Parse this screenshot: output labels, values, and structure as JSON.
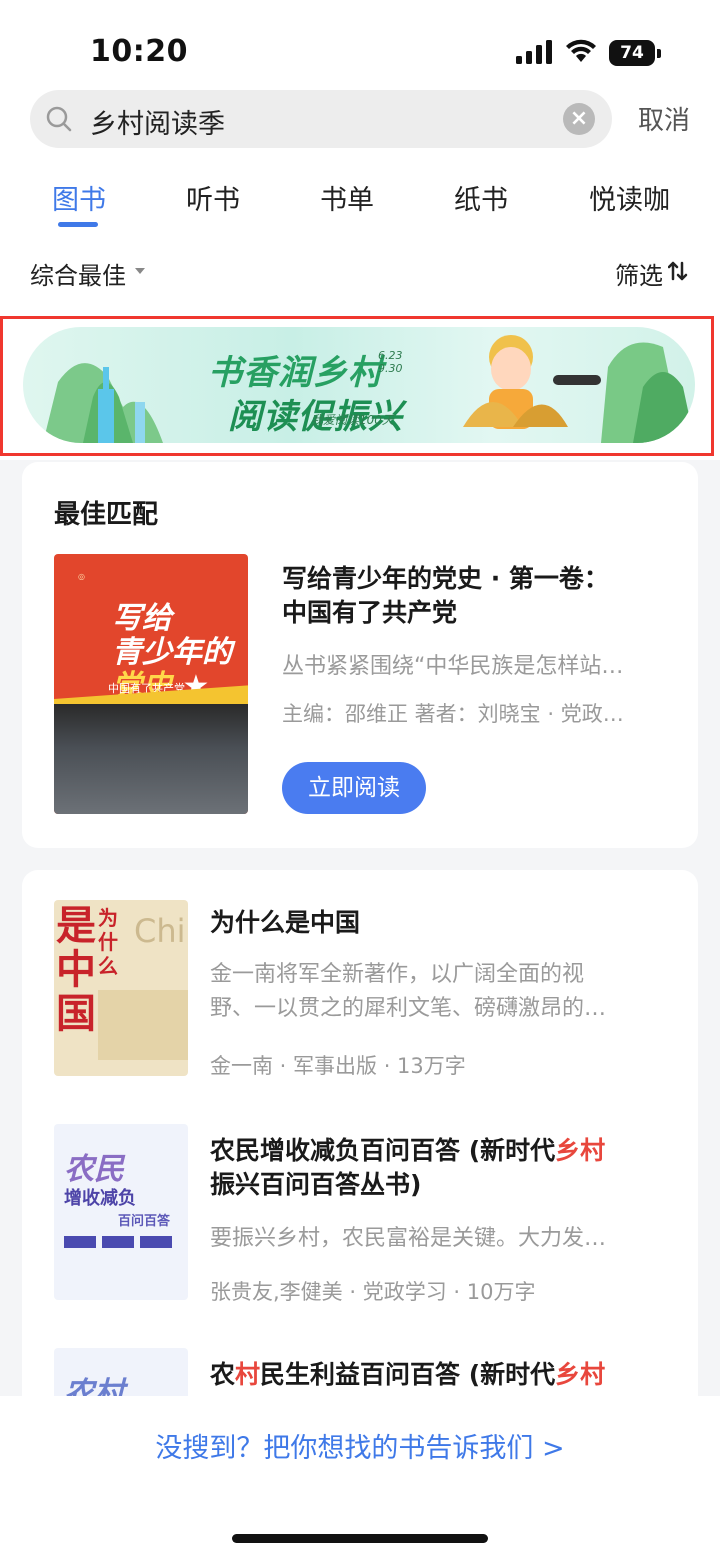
{
  "status_bar": {
    "time": "10:20",
    "battery": "74"
  },
  "search": {
    "query": "乡村阅读季",
    "cancel_label": "取消"
  },
  "tabs": [
    {
      "label": "图书",
      "active": true
    },
    {
      "label": "听书",
      "active": false
    },
    {
      "label": "书单",
      "active": false
    },
    {
      "label": "纸书",
      "active": false
    },
    {
      "label": "悦读咖",
      "active": false
    }
  ],
  "sort": {
    "label": "综合最佳",
    "filter_label": "筛选"
  },
  "banner": {
    "line1": "书香润乡村",
    "line2": "阅读促振兴",
    "date_start": "6.23",
    "date_end": "9.30",
    "subtitle": "我爱阅读100天"
  },
  "best_match": {
    "heading": "最佳匹配",
    "cover_line1": "写给",
    "cover_line2": "青少年的",
    "cover_line3": "党史",
    "cover_sub": "中国有了共产党",
    "title_line1": "写给青少年的党史 · 第一卷：",
    "title_line2": "中国有了共产党",
    "description": "丛书紧紧围绕“中华民族是怎样站…",
    "meta": "主编：邵维正 著者：刘晓宝 · 党政…",
    "read_button": "立即阅读"
  },
  "books": [
    {
      "cover_big": "是中国",
      "cover_small": "为什么",
      "cover_en": "China",
      "title": "为什么是中国",
      "desc_line1": "金一南将军全新著作，以广阔全面的视",
      "desc_line2": "野、一以贯之的犀利文笔、磅礴激昂的…",
      "meta": "金一南 ·  军事出版 · 13万字"
    },
    {
      "cover_t1": "农民",
      "cover_t2": "增收减负",
      "cover_t3": "百问百答",
      "title_part1": "农民增收减负百问百答 (新时代",
      "title_hl": "乡村",
      "title_line2": "振兴百问百答丛书)",
      "desc_line1": "要振兴乡村，农民富裕是关键。大力发…",
      "meta": "张贵友,李健美 ·  党政学习 · 10万字"
    },
    {
      "cover_t1": "农村",
      "title_part1": "农",
      "title_hl1": "村",
      "title_part2": "民生利益百问百答 (新时代",
      "title_hl2": "乡村"
    }
  ],
  "footer": {
    "link": "没搜到？把你想找的书告诉我们 >"
  },
  "colors": {
    "accent": "#3f79e8",
    "highlight": "#e8473d",
    "banner_frame": "#f0372f"
  }
}
